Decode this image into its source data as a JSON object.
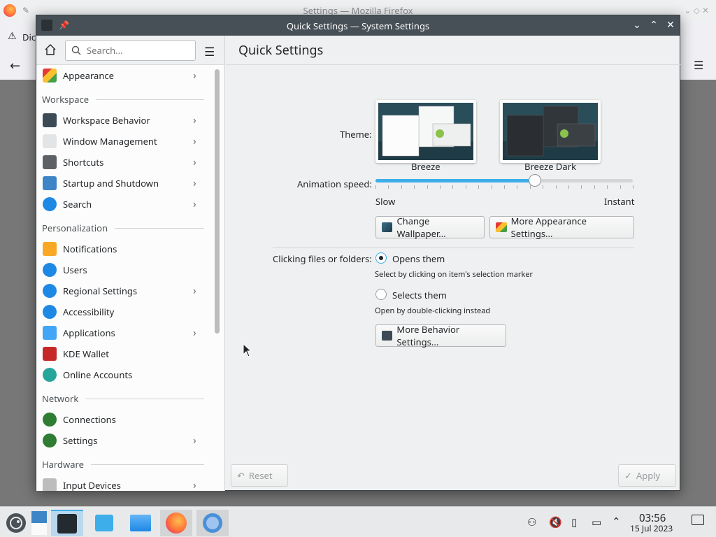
{
  "firefox": {
    "window_title": "Settings — Mozilla Firefox",
    "tab_fragment": "Dic"
  },
  "settings_window": {
    "title": "Quick Settings — System Settings"
  },
  "sidebar": {
    "search_placeholder": "Search...",
    "items": [
      {
        "label": "Appearance",
        "chevron": true,
        "icon": "appearance-icon"
      },
      {
        "section": "Workspace"
      },
      {
        "label": "Workspace Behavior",
        "chevron": true,
        "icon": "workspace-behavior-icon"
      },
      {
        "label": "Window Management",
        "chevron": true,
        "icon": "window-management-icon"
      },
      {
        "label": "Shortcuts",
        "chevron": true,
        "icon": "keyboard-icon"
      },
      {
        "label": "Startup and Shutdown",
        "chevron": true,
        "icon": "startup-icon"
      },
      {
        "label": "Search",
        "chevron": true,
        "icon": "search-globe-icon"
      },
      {
        "section": "Personalization"
      },
      {
        "label": "Notifications",
        "chevron": false,
        "icon": "bell-icon"
      },
      {
        "label": "Users",
        "chevron": false,
        "icon": "users-icon"
      },
      {
        "label": "Regional Settings",
        "chevron": true,
        "icon": "regional-icon"
      },
      {
        "label": "Accessibility",
        "chevron": false,
        "icon": "accessibility-icon"
      },
      {
        "label": "Applications",
        "chevron": true,
        "icon": "applications-icon"
      },
      {
        "label": "KDE Wallet",
        "chevron": false,
        "icon": "wallet-icon"
      },
      {
        "label": "Online Accounts",
        "chevron": false,
        "icon": "online-accounts-icon"
      },
      {
        "section": "Network"
      },
      {
        "label": "Connections",
        "chevron": false,
        "icon": "connections-icon"
      },
      {
        "label": "Settings",
        "chevron": true,
        "icon": "network-settings-icon"
      },
      {
        "section": "Hardware"
      },
      {
        "label": "Input Devices",
        "chevron": true,
        "icon": "mouse-icon"
      }
    ]
  },
  "main": {
    "title": "Quick Settings",
    "theme_label": "Theme:",
    "themes": [
      {
        "name": "Breeze",
        "selected": true
      },
      {
        "name": "Breeze Dark",
        "selected": false
      }
    ],
    "animation_label": "Animation speed:",
    "animation_min": "Slow",
    "animation_max": "Instant",
    "animation_value_fraction": 0.62,
    "change_wallpaper_btn": "Change Wallpaper...",
    "more_appearance_btn": "More Appearance Settings...",
    "clicking_label": "Clicking files or folders:",
    "opt_open": "Opens them",
    "opt_open_hint": "Select by clicking on item's selection marker",
    "opt_select": "Selects them",
    "opt_select_hint": "Open by double-clicking instead",
    "selected_option": "open",
    "more_behavior_btn": "More Behavior Settings...",
    "reset_btn": "Reset",
    "apply_btn": "Apply"
  },
  "taskbar": {
    "time": "03:56",
    "date": "15 Jul 2023"
  }
}
